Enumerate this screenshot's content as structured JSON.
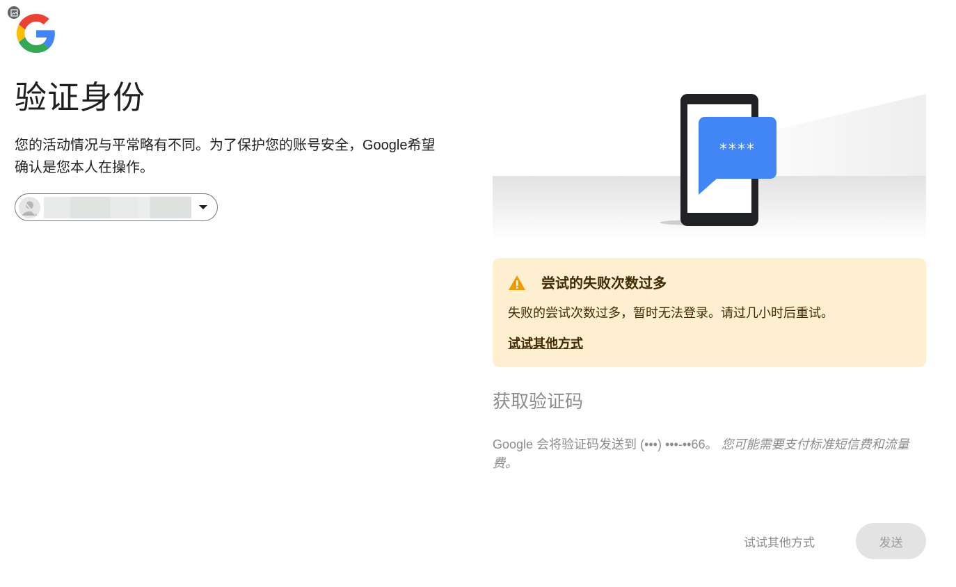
{
  "page": {
    "title": "验证身份",
    "description": "您的活动情况与平常略有不同。为了保护您的账号安全，Google希望确认是您本人在操作。"
  },
  "account_chip": {
    "email": ""
  },
  "illustration": {
    "code_text": "****"
  },
  "alert": {
    "title": "尝试的失败次数过多",
    "body": "失败的尝试次数过多，暂时无法登录。请过几小时后重试。",
    "link": "试试其他方式"
  },
  "section": {
    "title": "获取验证码",
    "info_prefix": "Google 会将验证码发送到 (•••) •••-••66。",
    "info_italic": "您可能需要支付标准短信费和流量费。"
  },
  "buttons": {
    "try_other": "试试其他方式",
    "send": "发送"
  },
  "colors": {
    "google_blue": "#4285F4",
    "google_red": "#EA4335",
    "google_yellow": "#FBBC05",
    "google_green": "#34A853",
    "alert_bg": "#FEEFD1",
    "alert_text": "#422A00",
    "disabled_text": "#8A8D8E",
    "send_button_bg": "#E3E3E3"
  }
}
